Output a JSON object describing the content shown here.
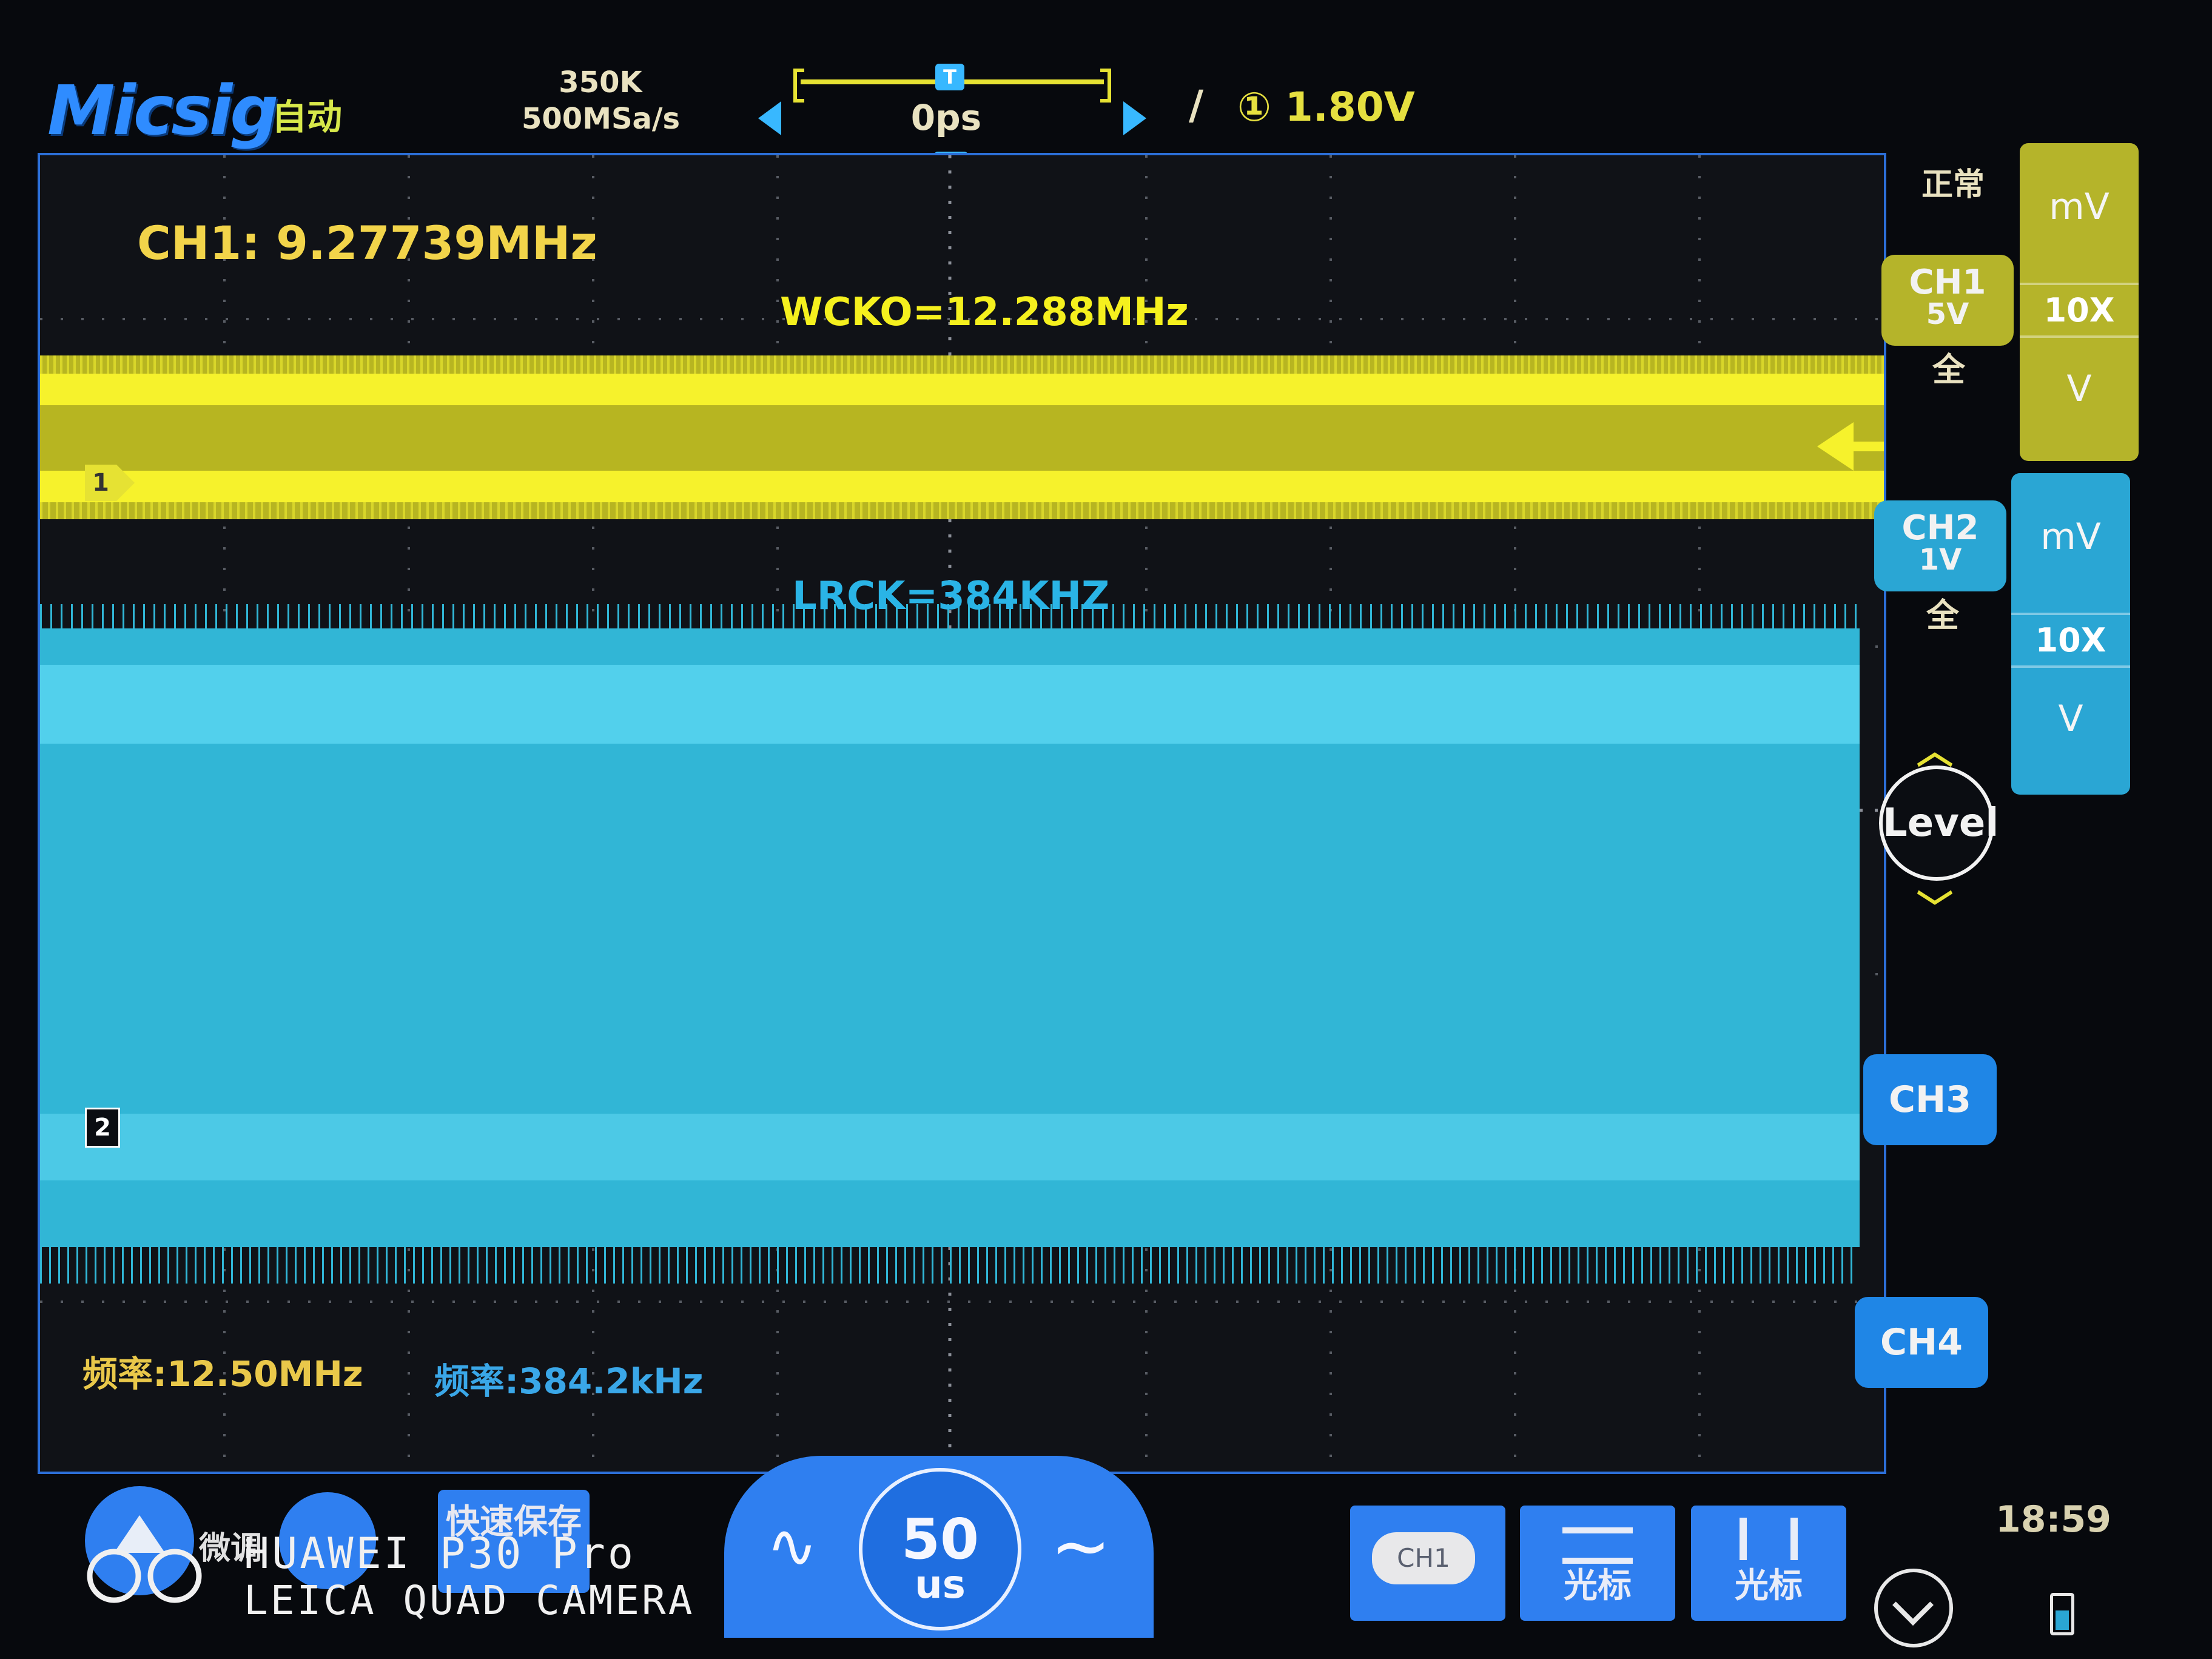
{
  "header": {
    "brand": "Micsig",
    "mode": "自动",
    "memory_depth": "350K",
    "sample_rate": "500MSa/s",
    "trigger_position_marker": "T",
    "horizontal_offset": "0ps",
    "trigger_source_symbol": "①",
    "trigger_level": "1.80V"
  },
  "screen": {
    "ch1_measure": "CH1: 9.27739MHz",
    "ch1_annotation": "WCKO=12.288MHz",
    "ch2_annotation": "LRCK=384KHZ",
    "ch1_marker": "1",
    "ch2_marker": "2",
    "ch1_freq": "频率:12.50MHz",
    "ch2_freq": "频率:384.2kHz"
  },
  "right_panel": {
    "acq_state": "正常",
    "ch1": {
      "name": "CH1",
      "scale": "5V",
      "coupling": "全",
      "color": "#b5b42a"
    },
    "ch2": {
      "name": "CH2",
      "scale": "1V",
      "coupling": "全",
      "color": "#2aa6d4"
    },
    "ch1_adjust": {
      "mv": "mV",
      "probe": "10X",
      "v": "V"
    },
    "ch2_adjust": {
      "mv": "mV",
      "probe": "10X",
      "v": "V"
    },
    "level_label": "Level",
    "ch3": "CH3",
    "ch4": "CH4"
  },
  "bottom_bar": {
    "fine_label": "微调",
    "quick_save": "快速保存",
    "timebase_value": "50",
    "timebase_unit": "us",
    "channel_pill": "CH1",
    "h_cursor_label": "光标",
    "v_cursor_label": "光标",
    "clock": "18:59"
  },
  "watermark": {
    "line1": "HUAWEI P30 Pro",
    "line2": "LEICA QUAD CAMERA"
  },
  "icons": [
    "up-arrow-icon",
    "sine-wave-icon",
    "level-icon",
    "menu-chevron-icon",
    "battery-icon",
    "horizontal-cursor-icon",
    "vertical-cursor-icon"
  ]
}
